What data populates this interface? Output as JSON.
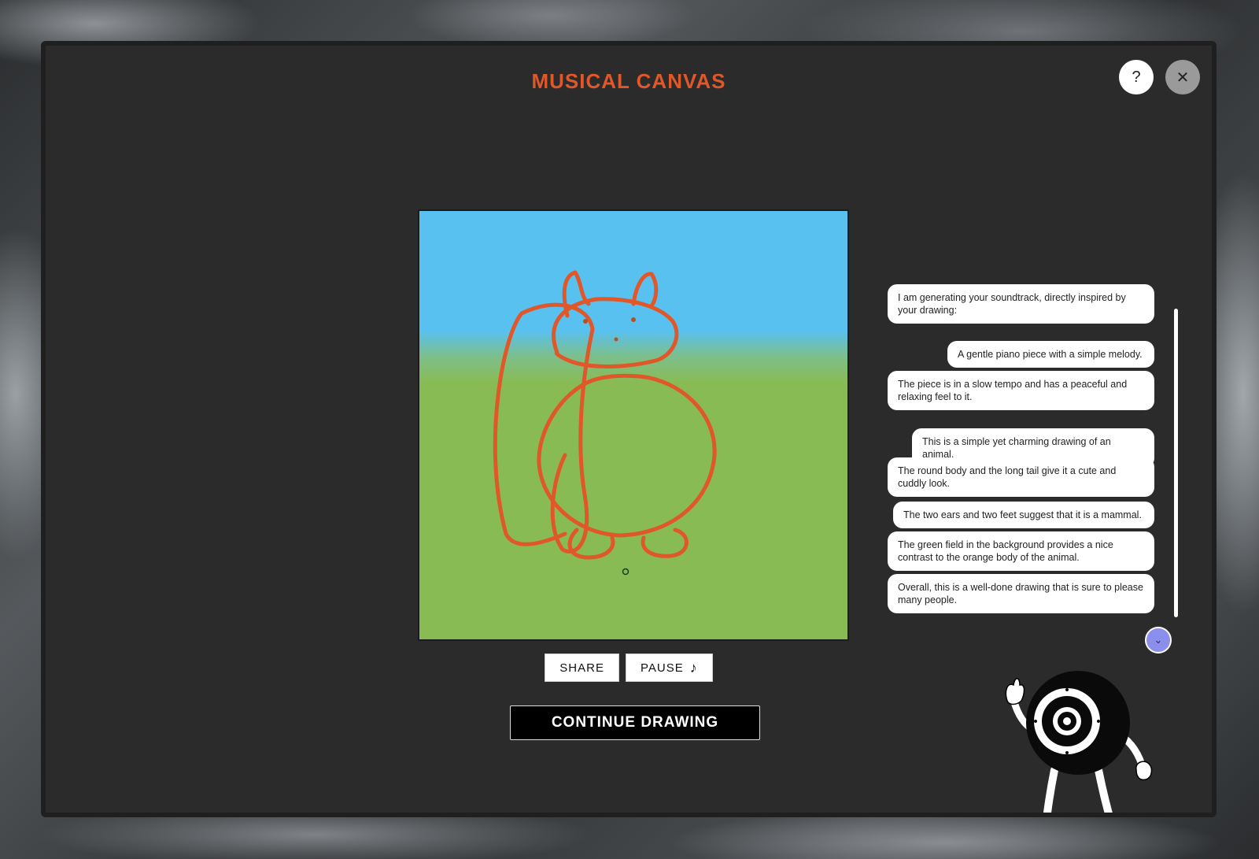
{
  "app": {
    "title": "MUSICAL CANVAS",
    "help_label": "?",
    "close_label": "✕"
  },
  "canvas": {
    "sky_color": "#59c1ef",
    "grass_color": "#89bb55",
    "stroke_color": "#e0582a"
  },
  "controls": {
    "share_label": "SHARE",
    "pause_label": "PAUSE",
    "pause_icon": "music-note-icon",
    "continue_label": "CONTINUE DRAWING"
  },
  "chat": {
    "messages": [
      {
        "text": "I am generating your soundtrack, directly inspired by your drawing:",
        "align": "left"
      },
      {
        "text": "A gentle piano piece with a simple melody.",
        "align": "right"
      },
      {
        "text": "The piece is in a slow tempo and has a peaceful and relaxing feel to it.",
        "align": "left"
      },
      {
        "text": "This is a simple yet charming drawing of an animal.",
        "align": "right"
      },
      {
        "text": "The round body and the long tail give it a cute and cuddly look.",
        "align": "left"
      },
      {
        "text": "The two ears and two feet suggest that it is a mammal.",
        "align": "right"
      },
      {
        "text": "The green field in the background provides a nice contrast to the orange body of the animal.",
        "align": "left"
      },
      {
        "text": "Overall, this is a well-done drawing that is sure to please many people.",
        "align": "left"
      }
    ],
    "scroll_icon": "chevron-down-icon"
  },
  "colors": {
    "accent": "#e0582a",
    "scroll_button": "#8a8fee"
  }
}
